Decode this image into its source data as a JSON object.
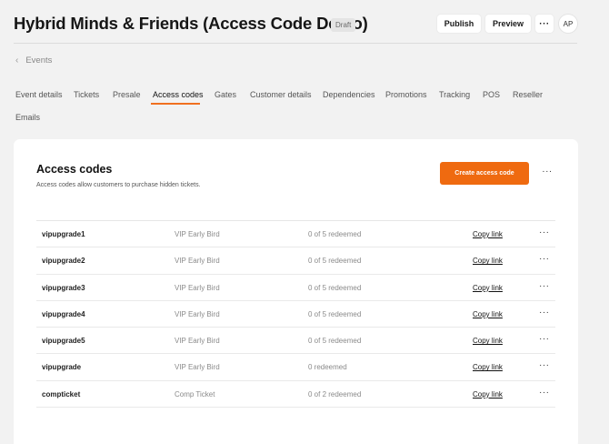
{
  "header": {
    "title": "Hybrid Minds & Friends (Access Code Demo)",
    "status_badge": "Draft",
    "publish_label": "Publish",
    "preview_label": "Preview",
    "more_label": "···",
    "avatar_initials": "AP"
  },
  "breadcrumb": {
    "back_label": "Events",
    "chevron": "‹"
  },
  "tabs": [
    {
      "label": "Event details",
      "active": false
    },
    {
      "label": "Tickets",
      "active": false
    },
    {
      "label": "Presale",
      "active": false
    },
    {
      "label": "Access codes",
      "active": true
    },
    {
      "label": "Gates",
      "active": false
    },
    {
      "label": "Customer details",
      "active": false
    },
    {
      "label": "Dependencies",
      "active": false
    },
    {
      "label": "Promotions",
      "active": false
    },
    {
      "label": "Tracking",
      "active": false
    },
    {
      "label": "POS",
      "active": false
    },
    {
      "label": "Reseller",
      "active": false
    },
    {
      "label": "Emails",
      "active": false
    }
  ],
  "panel": {
    "title": "Access codes",
    "subtitle": "Access codes allow customers to purchase hidden tickets.",
    "create_label": "Create access code",
    "more_label": "···"
  },
  "codes": [
    {
      "code": "vipupgrade1",
      "ticket": "VIP Early Bird",
      "redeemed": "0 of 5 redeemed",
      "link": "Copy link",
      "more": "···"
    },
    {
      "code": "vipupgrade2",
      "ticket": "VIP Early Bird",
      "redeemed": "0 of 5 redeemed",
      "link": "Copy link",
      "more": "···"
    },
    {
      "code": "vipupgrade3",
      "ticket": "VIP Early Bird",
      "redeemed": "0 of 5 redeemed",
      "link": "Copy link",
      "more": "···"
    },
    {
      "code": "vipupgrade4",
      "ticket": "VIP Early Bird",
      "redeemed": "0 of 5 redeemed",
      "link": "Copy link",
      "more": "···"
    },
    {
      "code": "vipupgrade5",
      "ticket": "VIP Early Bird",
      "redeemed": "0 of 5 redeemed",
      "link": "Copy link",
      "more": "···"
    },
    {
      "code": "vipupgrade",
      "ticket": "VIP Early Bird",
      "redeemed": "0 redeemed",
      "link": "Copy link",
      "more": "···"
    },
    {
      "code": "compticket",
      "ticket": "Comp Ticket",
      "redeemed": "0 of 2 redeemed",
      "link": "Copy link",
      "more": "···"
    }
  ],
  "colors": {
    "accent": "#ef6a10",
    "background": "#f2f2f2",
    "card": "#ffffff"
  }
}
